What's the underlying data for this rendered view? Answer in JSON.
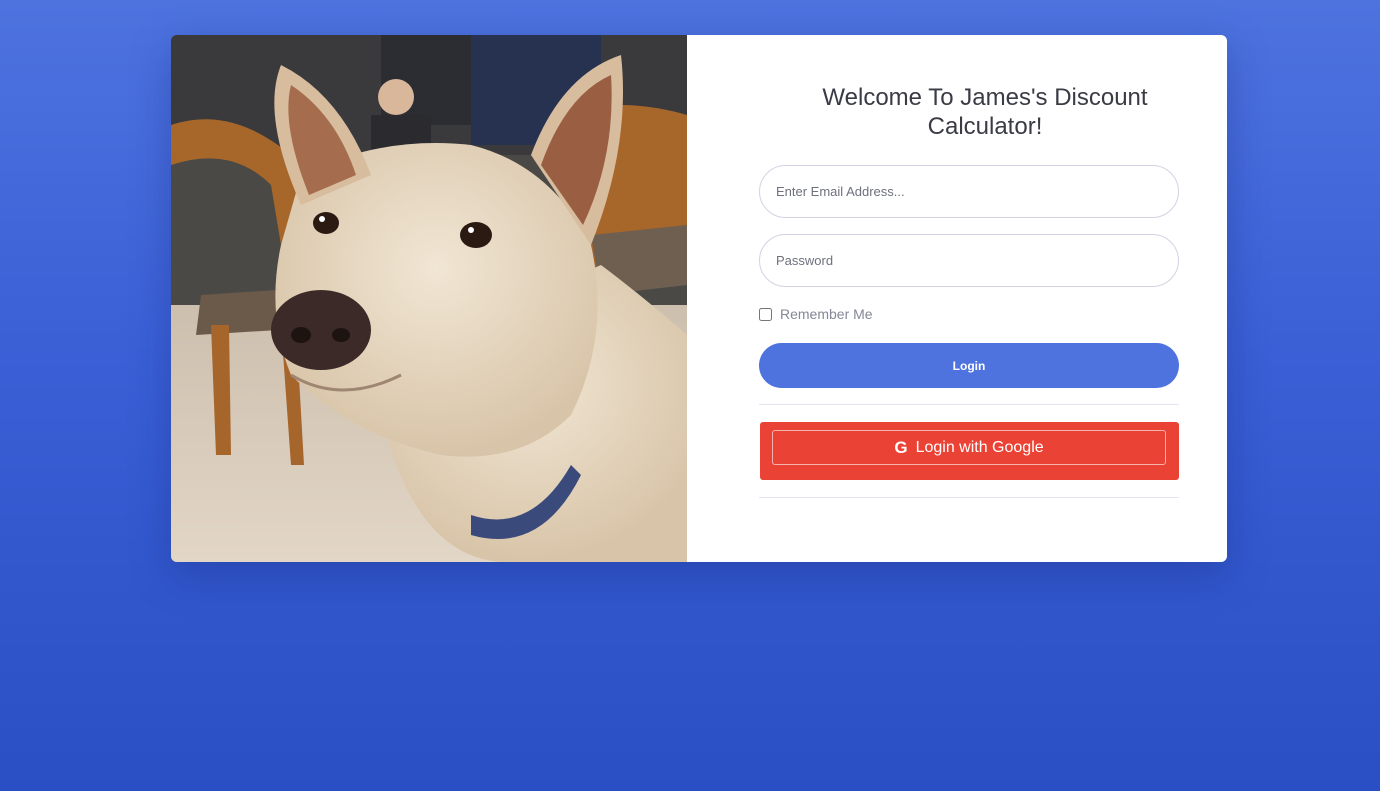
{
  "login": {
    "title": "Welcome To James's Discount Calculator!",
    "email_placeholder": "Enter Email Address...",
    "password_placeholder": "Password",
    "remember_label": "Remember Me",
    "remember_checked": false,
    "login_label": "Login",
    "google_label": "Login with Google",
    "google_icon": "google-icon"
  },
  "image": {
    "subject": "dog-photo"
  },
  "colors": {
    "primary": "#4e73df",
    "google": "#ea4335",
    "text": "#3a3b45"
  }
}
